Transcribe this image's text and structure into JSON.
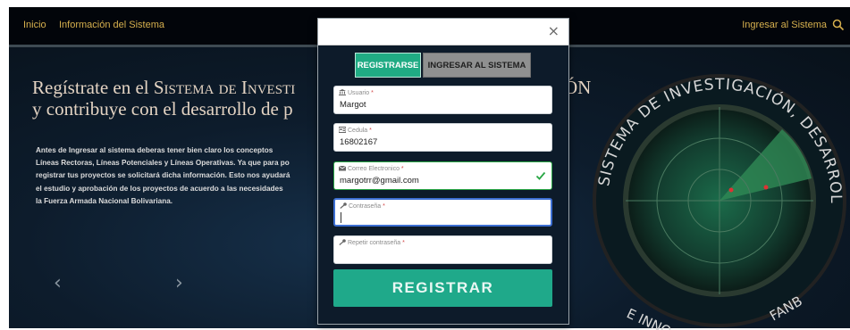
{
  "topnav": {
    "home": "Inicio",
    "info": "Información del Sistema",
    "login": "Ingresar al Sistema",
    "search_icon": "search-icon"
  },
  "hero": {
    "title_line1_prefix": "Regístrate en el ",
    "title_line1_sc": "Sistema de Investi",
    "title_line2": "y contribuye con el desarrollo de p",
    "title_right_fragment": "ÓN",
    "body": "Antes de Ingresar al sistema deberas tener bien claro los conceptos\nLíneas Rectoras, Líneas Potenciales y Líneas Operativas. Ya que para po\nregistrar tus proyectos se solicitará dicha información. Esto nos ayudará\nel estudio y aprobación de los proyectos de acuerdo a las necesidades\nla Fuerza Armada Nacional Bolivariana.",
    "carousel_prev": "‹",
    "carousel_next": "›",
    "emblem_text_top": "SISTEMA DE INVESTIGACIÓN, DESARROLLO",
    "emblem_text_bottom": "E INNO          FANB"
  },
  "modal": {
    "close": "×",
    "tabs": {
      "register": "REGISTRARSE",
      "login": "INGRESAR AL SISTEMA"
    },
    "fields": {
      "usuario": {
        "label": "Usuario",
        "required": "*",
        "value": "Margot"
      },
      "cedula": {
        "label": "Cedula",
        "required": "*",
        "value": "16802167"
      },
      "correo": {
        "label": "Correo Electronico",
        "required": "*",
        "value": "margotrr@gmail.com"
      },
      "contrasena": {
        "label": "Contraseña",
        "required": "*",
        "value": ""
      },
      "repetir": {
        "label": "Repetir contraseña",
        "required": "*",
        "value": ""
      }
    },
    "submit": "REGISTRAR"
  },
  "colors": {
    "accent_green": "#20ab84",
    "nav_gold": "#d7b04e",
    "valid_green": "#29a745",
    "focus_blue": "#3d6fd3"
  }
}
